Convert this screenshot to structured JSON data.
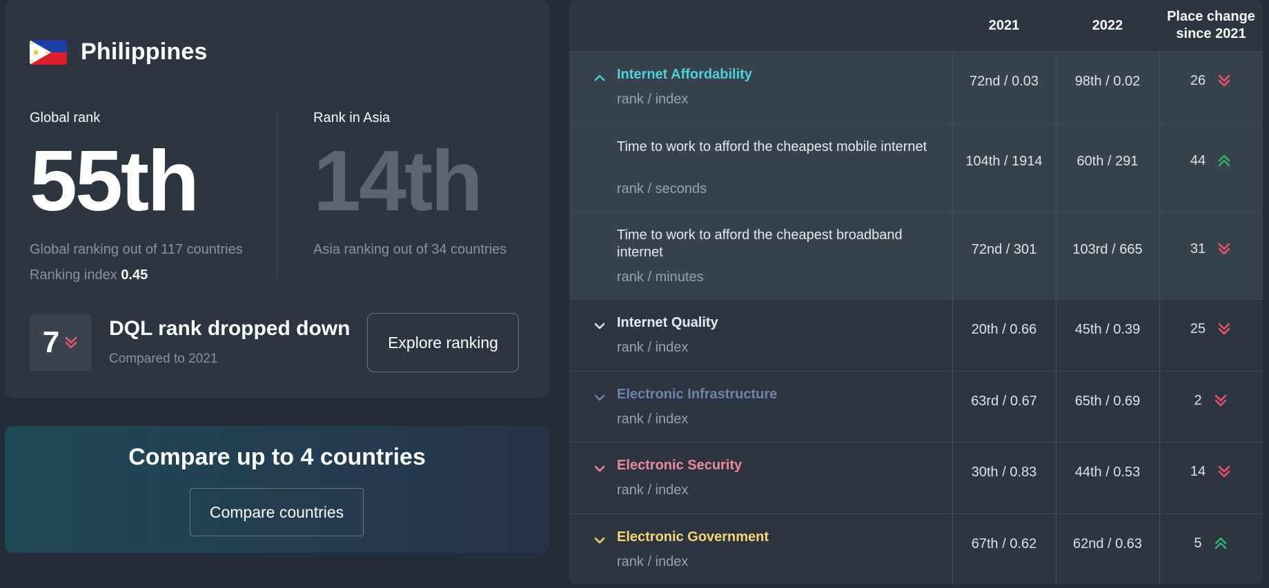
{
  "country": {
    "name": "Philippines",
    "flag_icon": "philippines-flag-icon",
    "global": {
      "label": "Global rank",
      "value": "55th",
      "description": "Global ranking out of 117 countries",
      "index_label": "Ranking index",
      "index_value": "0.45"
    },
    "asia": {
      "label": "Rank in Asia",
      "value": "14th",
      "description": "Asia ranking out of 34 countries"
    },
    "change": {
      "value": "7",
      "direction": "down",
      "title": "DQL rank dropped down",
      "subtitle": "Compared to 2021"
    },
    "explore_label": "Explore ranking"
  },
  "compare": {
    "title": "Compare up to 4 countries",
    "button_label": "Compare countries"
  },
  "table": {
    "headers": {
      "y2021": "2021",
      "y2022": "2022",
      "place_change": "Place change since 2021"
    },
    "colors": {
      "affordability": "#4fd1d9",
      "quality": "#e9ecef",
      "infrastructure": "#6f86ab",
      "security": "#f08aa0",
      "government": "#f6d774",
      "up": "#2fb36d",
      "down": "#f0506e"
    },
    "rows": [
      {
        "title": "Internet Affordability",
        "unit": "rank / index",
        "v2021": "72nd / 0.03",
        "v2022": "98th / 0.02",
        "change": "26",
        "direction": "down",
        "chevron": "chevron-up-icon"
      },
      {
        "title": "Time to work to afford the cheapest mobile internet",
        "unit": "rank / seconds",
        "v2021": "104th / 1914",
        "v2022": "60th / 291",
        "change": "44",
        "direction": "up"
      },
      {
        "title": "Time to work to afford the cheapest broadband internet",
        "unit": "rank / minutes",
        "v2021": "72nd / 301",
        "v2022": "103rd / 665",
        "change": "31",
        "direction": "down"
      },
      {
        "title": "Internet Quality",
        "unit": "rank / index",
        "v2021": "20th / 0.66",
        "v2022": "45th / 0.39",
        "change": "25",
        "direction": "down",
        "chevron": "chevron-down-icon"
      },
      {
        "title": "Electronic Infrastructure",
        "unit": "rank / index",
        "v2021": "63rd / 0.67",
        "v2022": "65th / 0.69",
        "change": "2",
        "direction": "down",
        "chevron": "chevron-down-icon"
      },
      {
        "title": "Electronic Security",
        "unit": "rank / index",
        "v2021": "30th / 0.83",
        "v2022": "44th / 0.53",
        "change": "14",
        "direction": "down",
        "chevron": "chevron-down-icon"
      },
      {
        "title": "Electronic Government",
        "unit": "rank / index",
        "v2021": "67th / 0.62",
        "v2022": "62nd / 0.63",
        "change": "5",
        "direction": "up",
        "chevron": "chevron-down-icon"
      }
    ]
  }
}
